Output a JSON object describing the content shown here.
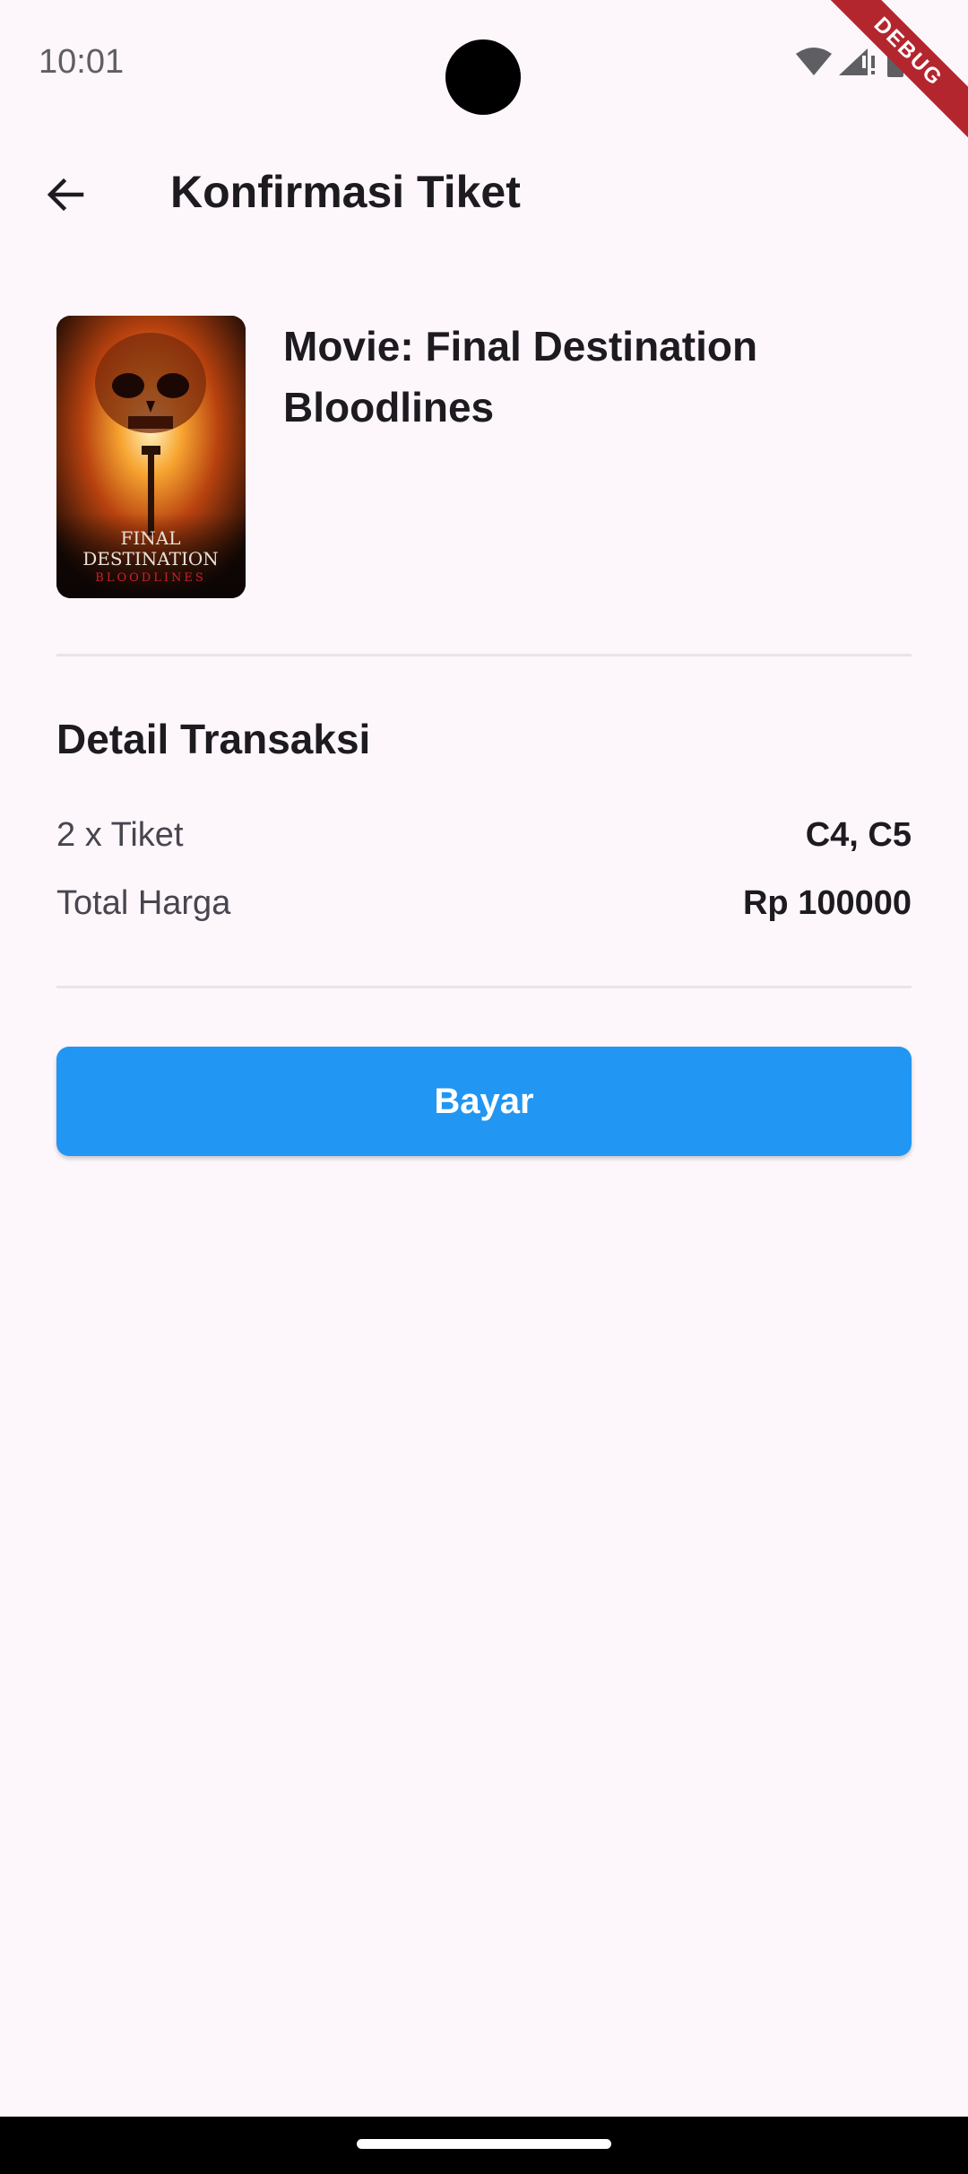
{
  "status_bar": {
    "time": "10:01",
    "debug_label": "DEBUG",
    "icons": [
      "wifi-icon",
      "cell-signal-icon",
      "battery-icon"
    ]
  },
  "app_bar": {
    "title": "Konfirmasi Tiket",
    "back_icon": "arrow-back-icon"
  },
  "movie": {
    "title": "Movie: Final Destination Bloodlines",
    "poster": {
      "line1": "FINAL",
      "line2": "DESTINATION",
      "line3": "BLOODLINES"
    }
  },
  "transaction": {
    "heading": "Detail Transaksi",
    "rows": [
      {
        "label": "2 x Tiket",
        "value": "C4, C5"
      },
      {
        "label": "Total Harga",
        "value": "Rp 100000"
      }
    ]
  },
  "actions": {
    "pay_label": "Bayar"
  },
  "colors": {
    "background": "#fdf7fc",
    "primary_button": "#2196f3",
    "debug_ribbon": "#b3262e"
  }
}
